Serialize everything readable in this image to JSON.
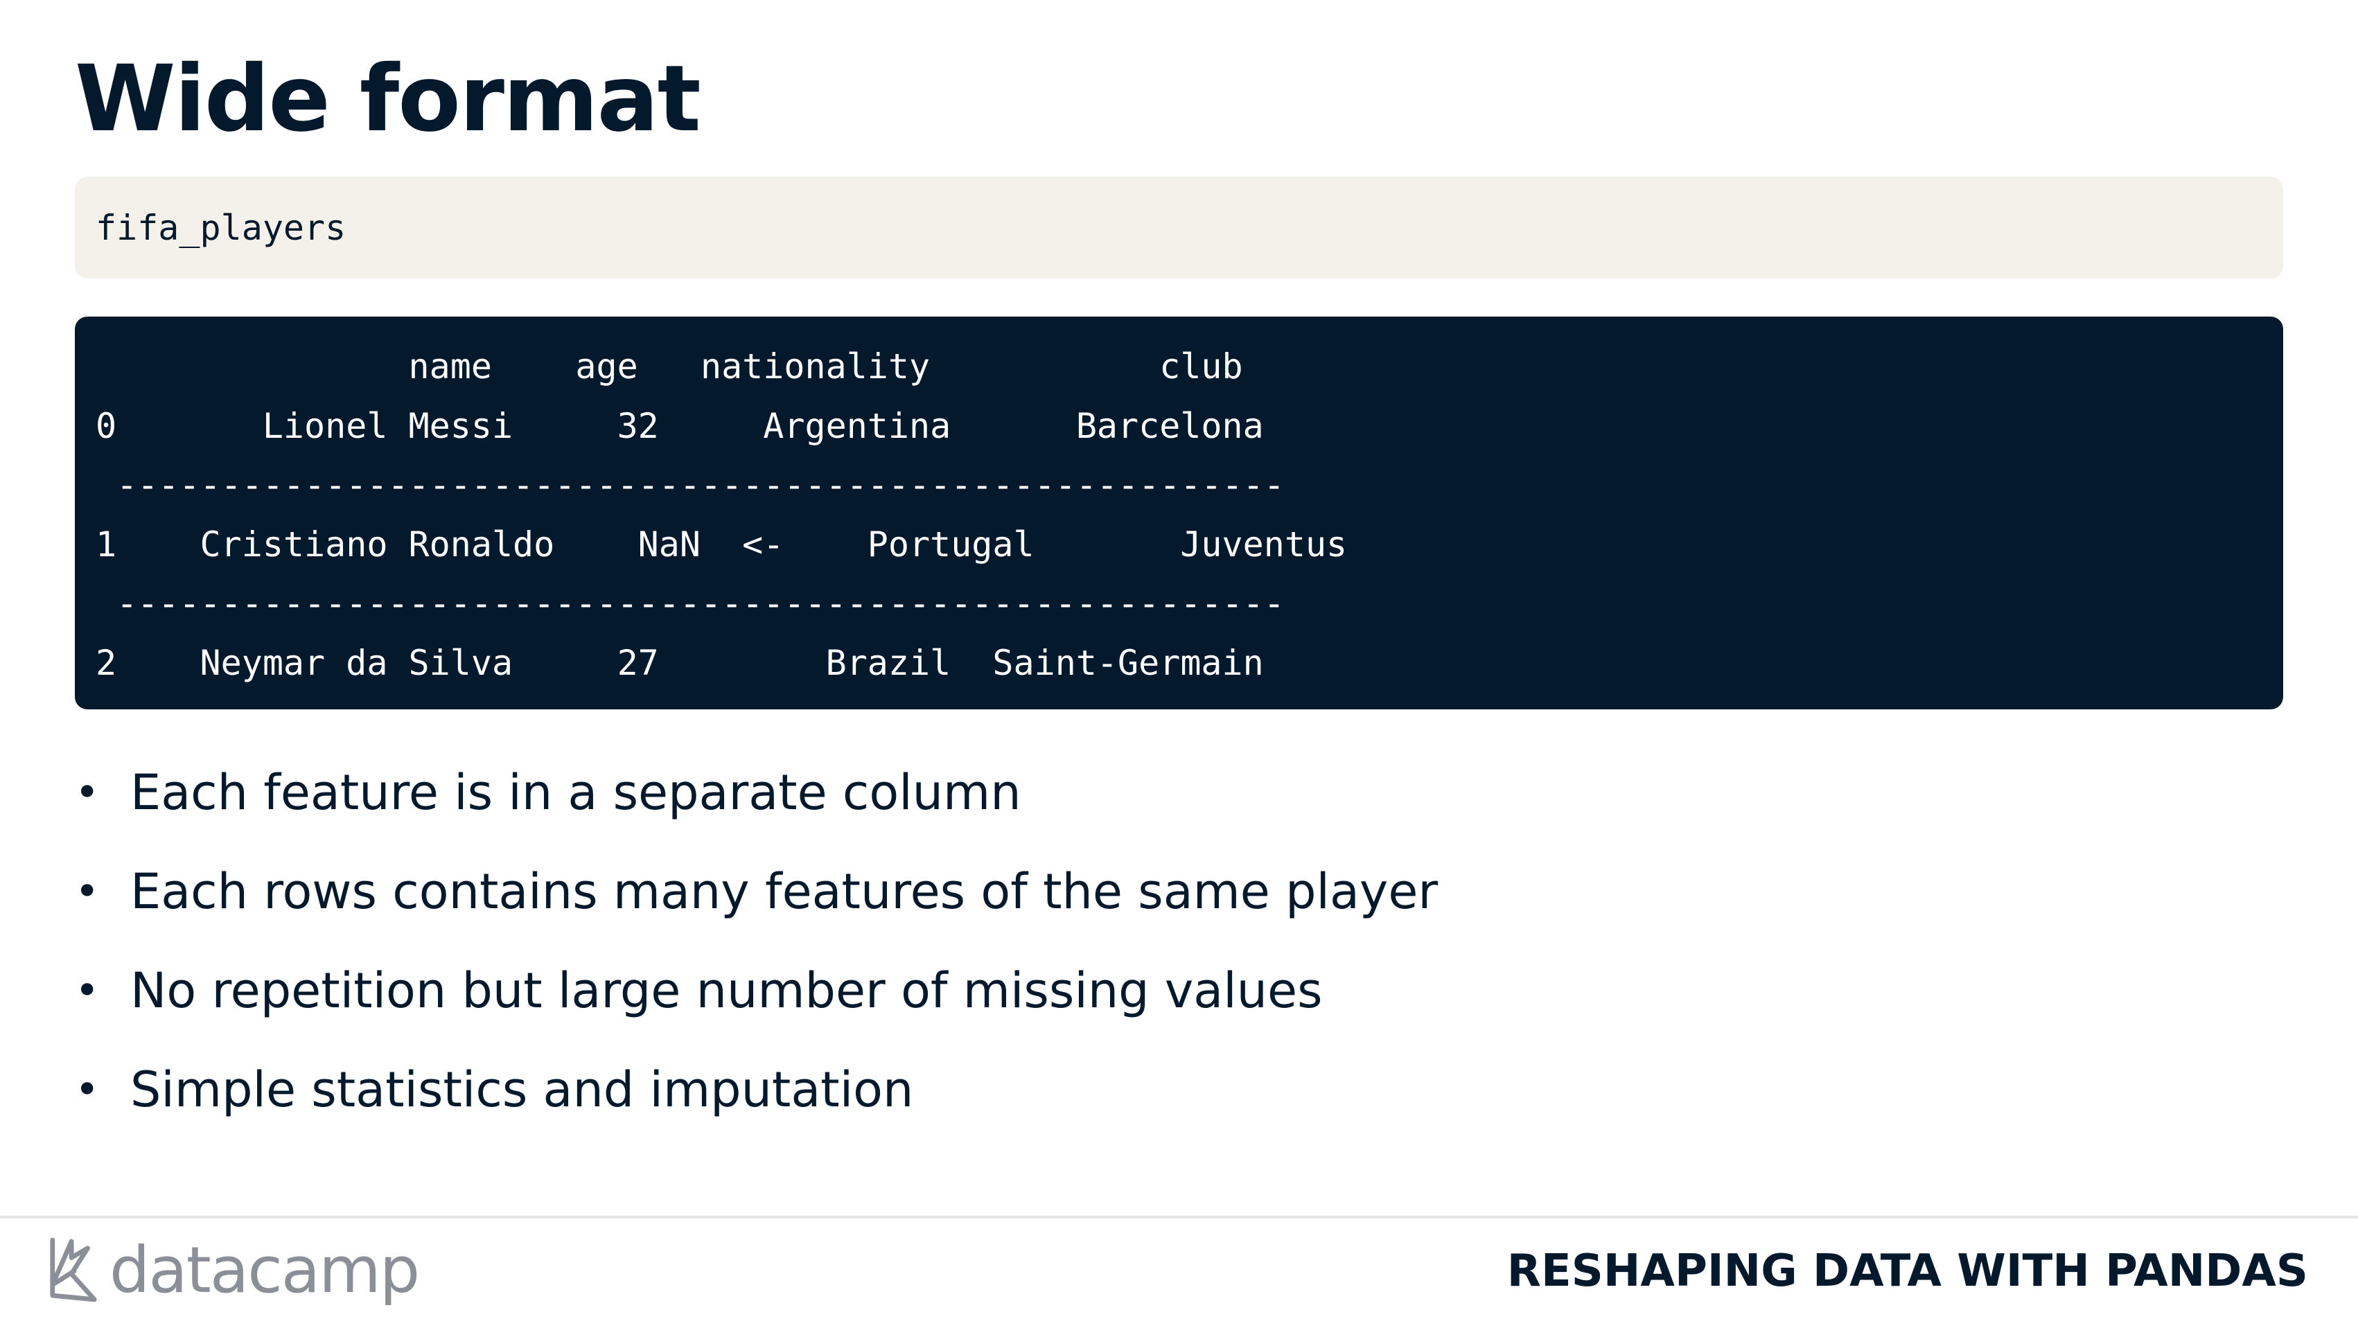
{
  "slide": {
    "title": "Wide format"
  },
  "code_input": {
    "text": "fifa_players"
  },
  "code_output": {
    "lines": [
      "               name    age   nationality           club",
      "0       Lionel Messi     32     Argentina      Barcelona",
      " --------------------------------------------------------",
      "1    Cristiano Ronaldo    NaN  <-    Portugal       Juventus",
      " --------------------------------------------------------",
      "2    Neymar da Silva     27        Brazil  Saint-Germain"
    ]
  },
  "bullets": [
    "Each feature is in a separate column",
    "Each rows contains many features of the same player",
    "No repetition but large number of missing values",
    "Simple statistics and imputation"
  ],
  "footer": {
    "logo_text": "datacamp",
    "course_title": "RESHAPING DATA WITH PANDAS"
  },
  "colors": {
    "navy": "#05192d",
    "code_input_bg": "#f4f1ea",
    "logo_gray": "#8a8f98"
  }
}
